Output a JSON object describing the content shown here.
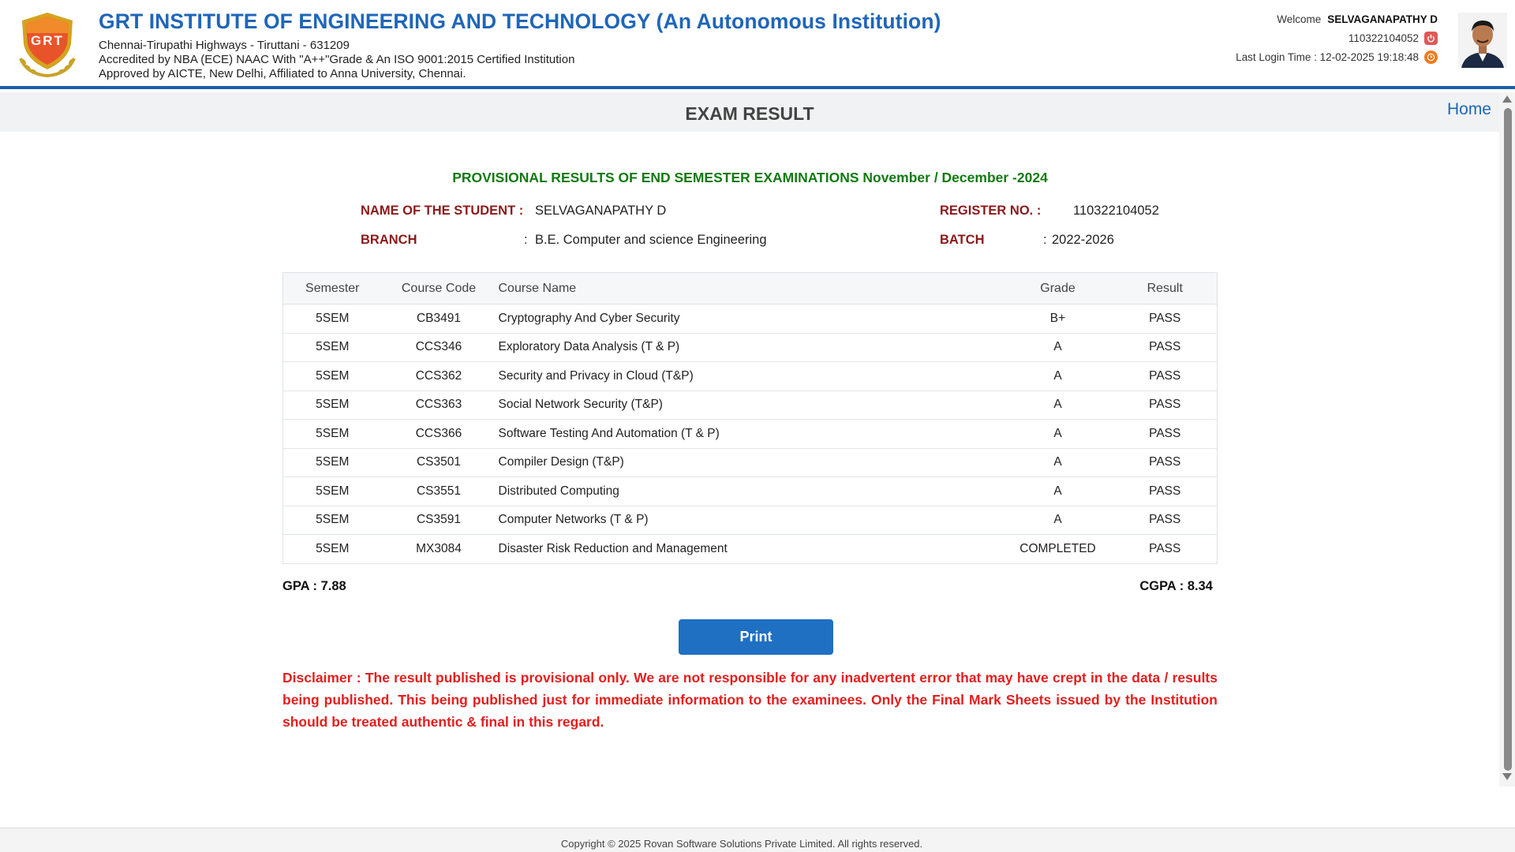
{
  "header": {
    "logo_text": "GRT",
    "institution_title": "GRT INSTITUTE OF ENGINEERING AND TECHNOLOGY (An Autonomous Institution)",
    "address": "Chennai-Tirupathi Highways - Tiruttani - 631209",
    "accreditation": "Accredited by NBA (ECE) NAAC With \"A++\"Grade & An ISO 9001:2015 Certified Institution",
    "approval": "Approved by AICTE, New Delhi, Affiliated to Anna University, Chennai.",
    "accent_color": "#1f66b8"
  },
  "user": {
    "welcome_label": "Welcome",
    "name": "SELVAGANAPATHY D",
    "register_no": "110322104052",
    "last_login": "Last Login Time : 12-02-2025 19:18:48",
    "logout_icon": "power-icon",
    "clock_icon": "clock-icon"
  },
  "titlebar": {
    "title": "EXAM RESULT",
    "home_link": "Home"
  },
  "result": {
    "heading": "PROVISIONAL RESULTS OF END SEMESTER EXAMINATIONS November / December -2024",
    "student_name_label": "NAME OF THE STUDENT :",
    "student_name": "SELVAGANAPATHY D",
    "register_label": "REGISTER NO. :",
    "register_no": "110322104052",
    "branch_label": "BRANCH",
    "branch": "B.E. Computer and science Engineering",
    "batch_label": "BATCH",
    "batch": "2022-2026",
    "colon": ":"
  },
  "table": {
    "headers": {
      "semester": "Semester",
      "course_code": "Course Code",
      "course_name": "Course Name",
      "grade": "Grade",
      "result": "Result"
    },
    "rows": [
      {
        "semester": "5SEM",
        "course_code": "CB3491",
        "course_name": "Cryptography And Cyber Security",
        "grade": "B+",
        "result": "PASS"
      },
      {
        "semester": "5SEM",
        "course_code": "CCS346",
        "course_name": "Exploratory Data Analysis (T & P)",
        "grade": "A",
        "result": "PASS"
      },
      {
        "semester": "5SEM",
        "course_code": "CCS362",
        "course_name": "Security and Privacy in Cloud (T&P)",
        "grade": "A",
        "result": "PASS"
      },
      {
        "semester": "5SEM",
        "course_code": "CCS363",
        "course_name": "Social Network Security (T&P)",
        "grade": "A",
        "result": "PASS"
      },
      {
        "semester": "5SEM",
        "course_code": "CCS366",
        "course_name": "Software Testing And Automation (T & P)",
        "grade": "A",
        "result": "PASS"
      },
      {
        "semester": "5SEM",
        "course_code": "CS3501",
        "course_name": "Compiler Design (T&P)",
        "grade": "A",
        "result": "PASS"
      },
      {
        "semester": "5SEM",
        "course_code": "CS3551",
        "course_name": "Distributed Computing",
        "grade": "A",
        "result": "PASS"
      },
      {
        "semester": "5SEM",
        "course_code": "CS3591",
        "course_name": "Computer Networks (T & P)",
        "grade": "A",
        "result": "PASS"
      },
      {
        "semester": "5SEM",
        "course_code": "MX3084",
        "course_name": "Disaster Risk Reduction and Management",
        "grade": "COMPLETED",
        "result": "PASS"
      }
    ]
  },
  "summary": {
    "gpa": "GPA : 7.88",
    "cgpa": "CGPA : 8.34"
  },
  "actions": {
    "print_label": "Print"
  },
  "disclaimer": "Disclaimer : The result published is provisional only. We are not responsible for any inadvertent error that may have crept in the data / results being published. This being published just for immediate information to the examinees. Only the Final Mark Sheets issued by the Institution should be treated authentic & final in this regard.",
  "footer": {
    "copyright": "Copyright © 2025 Rovan Software Solutions Private Limited. All rights reserved."
  }
}
